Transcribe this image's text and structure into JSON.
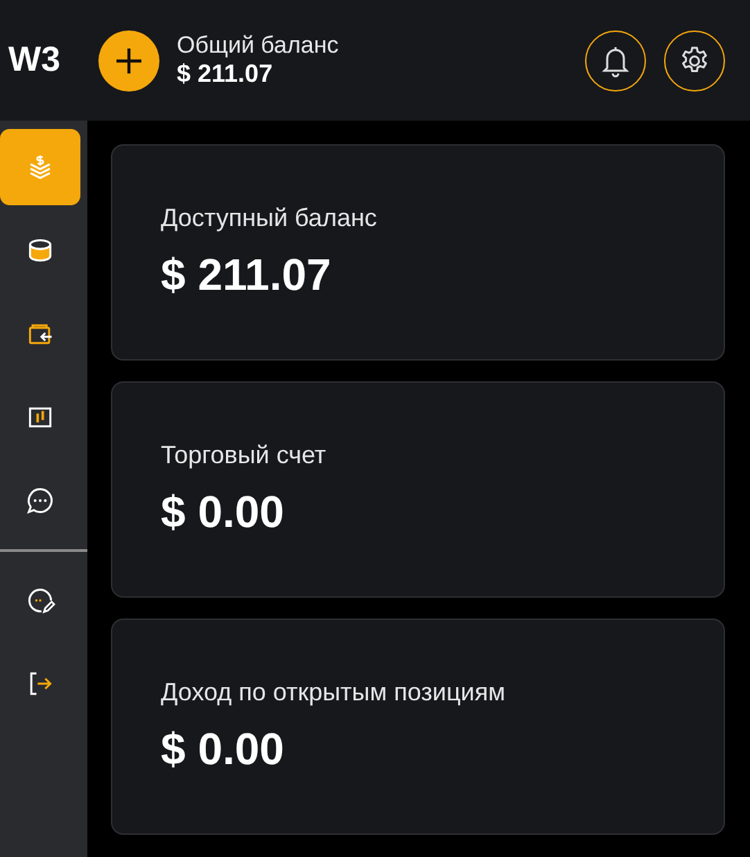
{
  "header": {
    "logo": "W3",
    "balance_label": "Общий баланс",
    "balance_value": "$ 211.07"
  },
  "sidebar": {
    "items": [
      {
        "selected": true
      },
      {
        "selected": false
      },
      {
        "selected": false
      },
      {
        "selected": false
      },
      {
        "selected": false
      }
    ],
    "bottom_items": [
      {
        "selected": false
      },
      {
        "selected": false
      }
    ]
  },
  "cards": [
    {
      "label": "Доступный баланс",
      "value": "$ 211.07"
    },
    {
      "label": "Торговый счет",
      "value": "$ 0.00"
    },
    {
      "label": "Доход по открытым позициям",
      "value": "$ 0.00"
    }
  ]
}
